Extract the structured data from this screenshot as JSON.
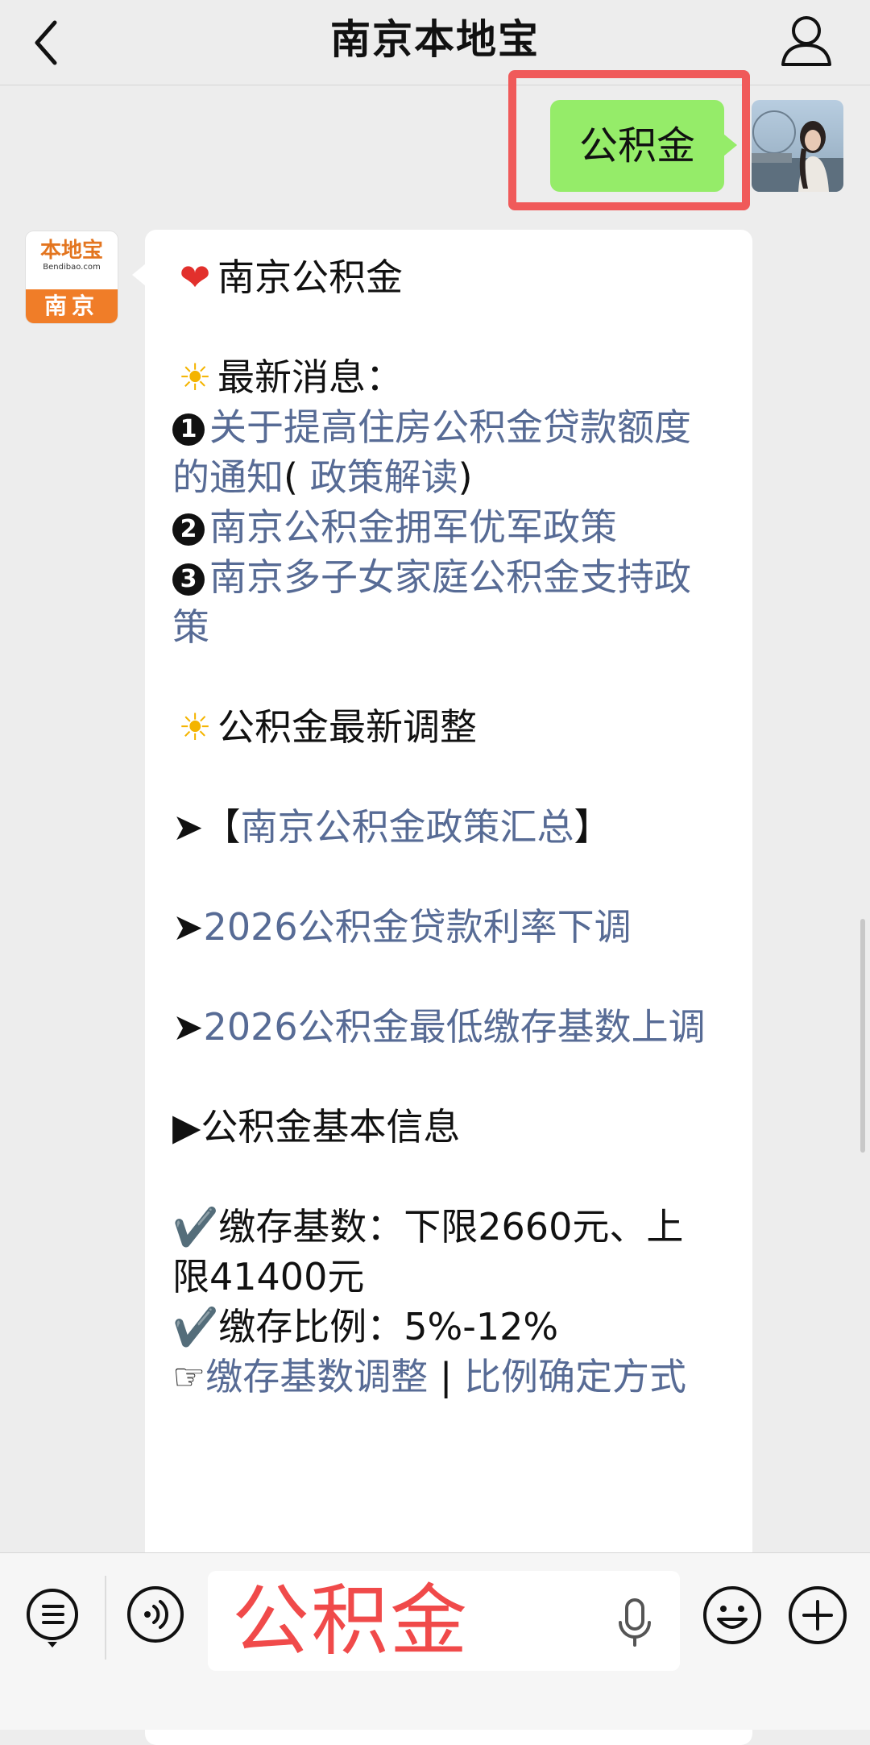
{
  "header": {
    "title": "南京本地宝"
  },
  "outgoing_message": {
    "text": "公积金"
  },
  "bot_avatar": {
    "brand": "本地宝",
    "domain": "Bendibao.com",
    "city": "南京"
  },
  "incoming_message": {
    "heading": "南京公积金",
    "news_title": "最新消息：",
    "news_items": [
      {
        "num": "1",
        "text": "关于提高住房公积金贷款额度的通知",
        "extra_open": "( ",
        "extra_link": "政策解读",
        "extra_close": ")"
      },
      {
        "num": "2",
        "text": "南京公积金拥军优军政策"
      },
      {
        "num": "3",
        "text": "南京多子女家庭公积金支持政策"
      }
    ],
    "adjust_title": "公积金最新调整",
    "adjust_links": [
      {
        "prefix": "➤【",
        "text": "南京公积金政策汇总",
        "suffix": "】"
      },
      {
        "prefix": "➤",
        "text": "2026公积金贷款利率下调",
        "suffix": ""
      },
      {
        "prefix": "➤",
        "text": "2026公积金最低缴存基数上调",
        "suffix": ""
      }
    ],
    "basic_title": "▶公积金基本信息",
    "base_line": "✔️缴存基数：下限2660元、上限41400元",
    "ratio_line": "✔️缴存比例：5%-12%",
    "pointer": "☞",
    "link_base_adjust": "缴存基数调整",
    "separator": " | ",
    "link_ratio": "比例确定方式"
  },
  "input_bar": {
    "text": "公积金"
  },
  "icons": {
    "back": "chevron-left-icon",
    "profile": "person-icon",
    "menu": "list-menu-icon",
    "voice": "voice-wave-icon",
    "mic": "microphone-icon",
    "emoji": "smiley-icon",
    "plus": "plus-icon"
  },
  "colors": {
    "background": "#ededed",
    "outgoing_bubble": "#95ec69",
    "highlight": "#f05a5a",
    "link": "#576b95",
    "input_text": "#f04a4a"
  }
}
